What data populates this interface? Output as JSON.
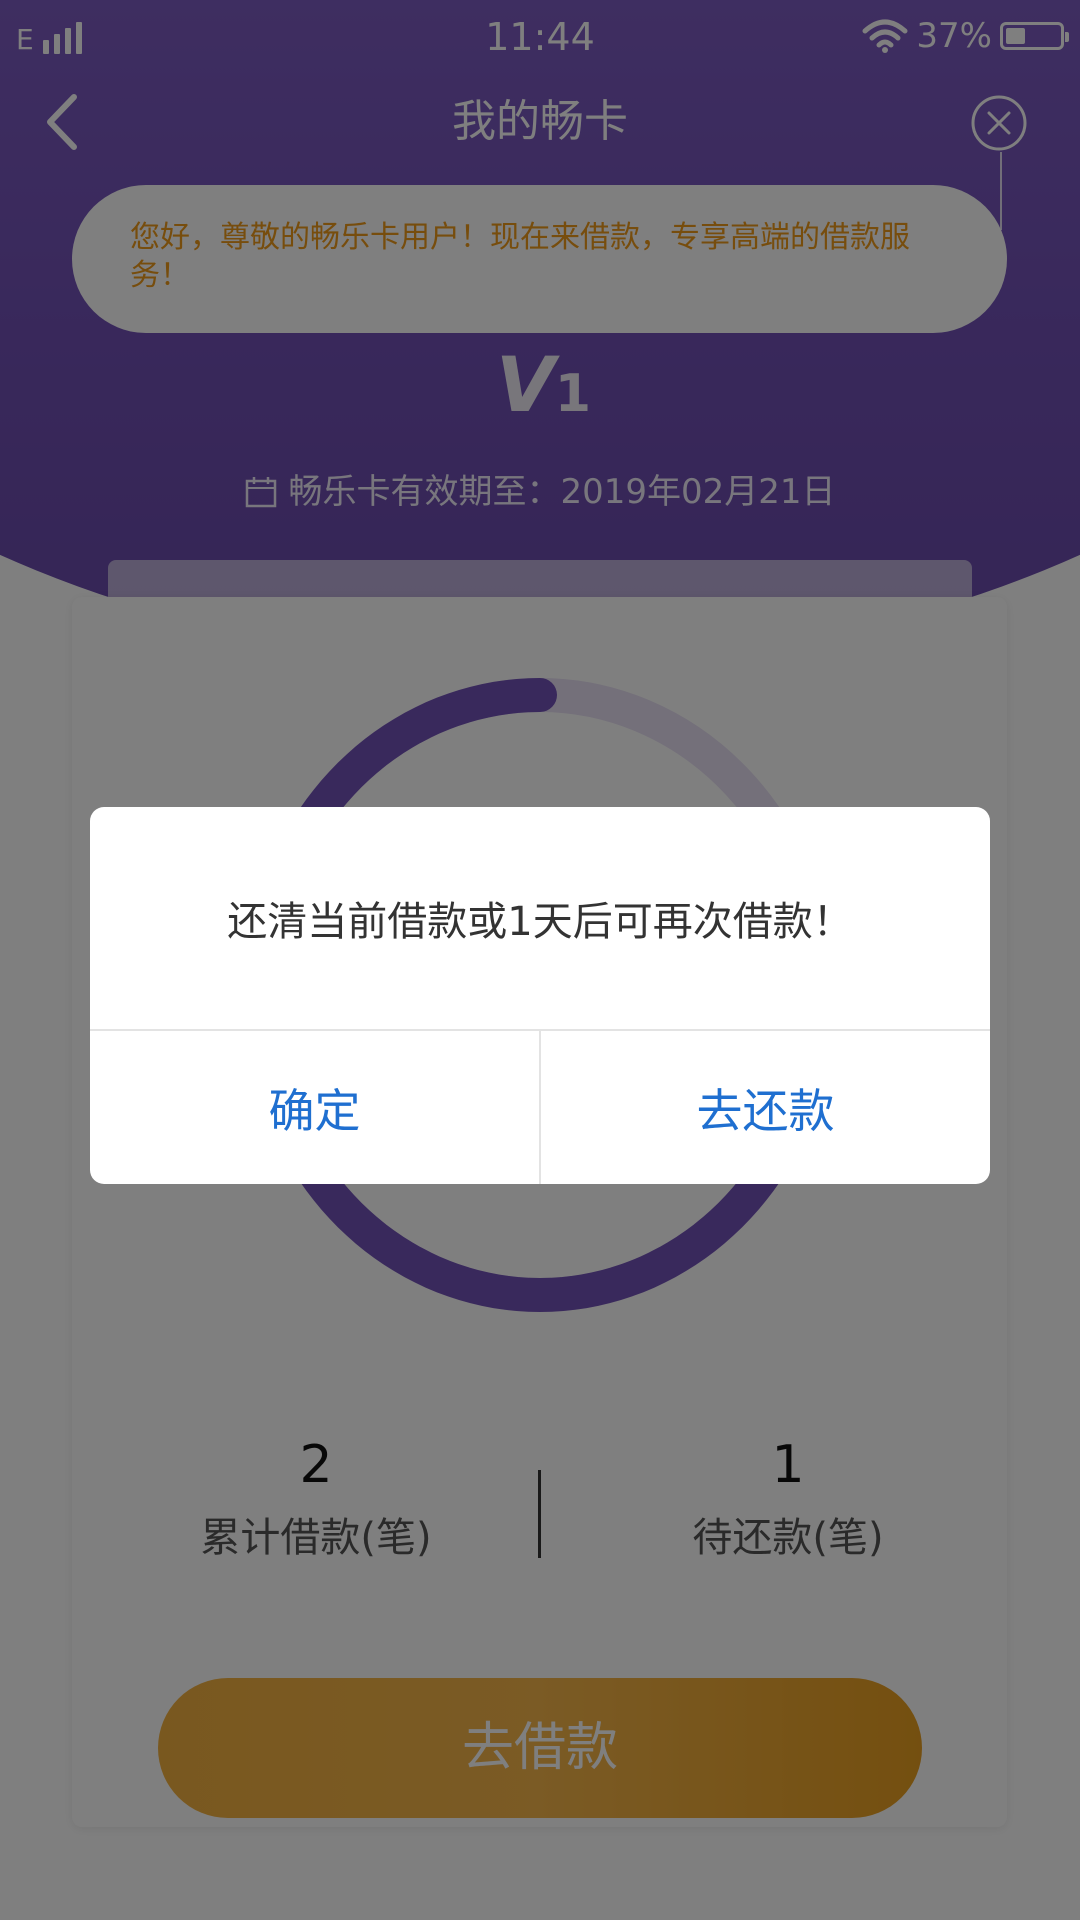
{
  "status_bar": {
    "network": "E",
    "time": "11:44",
    "battery_percent": "37%",
    "battery_level": 0.37
  },
  "nav": {
    "title": "我的畅卡"
  },
  "notice": {
    "text": "您好，尊敬的畅乐卡用户！现在来借款，专享高端的借款服务！"
  },
  "level_badge": {
    "letter": "V",
    "number": "1"
  },
  "validity": {
    "text": "畅乐卡有效期至：2019年02月21日"
  },
  "stats": {
    "total": {
      "value": "2",
      "label": "累计借款(笔)"
    },
    "pending": {
      "value": "1",
      "label": "待还款(笔)"
    }
  },
  "borrow_button": {
    "label": "去借款"
  },
  "dialog": {
    "message": "还清当前借款或1天后可再次借款！",
    "confirm_label": "确定",
    "repay_label": "去还款"
  },
  "colors": {
    "primary_purple": "#7352b8",
    "accent_orange": "#f3b13f",
    "notice_text": "#ef9a1a",
    "dialog_button": "#1f6fd0"
  }
}
